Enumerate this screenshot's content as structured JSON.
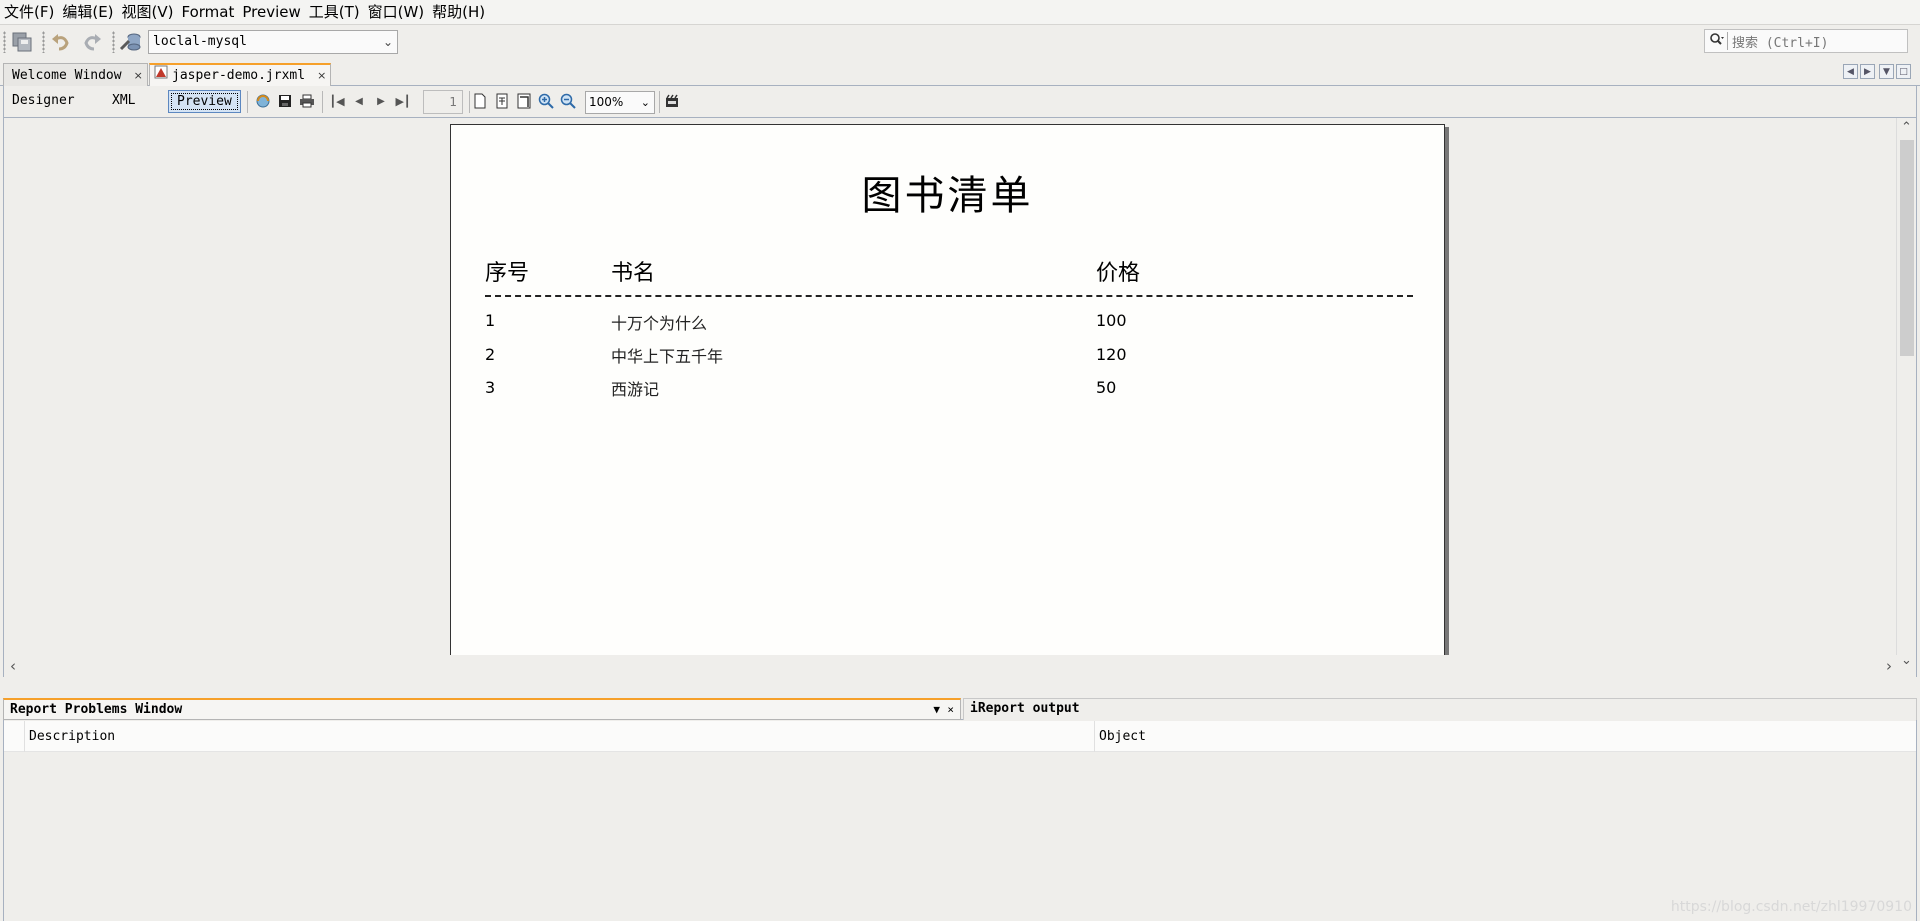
{
  "menu": [
    "文件(F)",
    "编辑(E)",
    "视图(V)",
    "Format",
    "Preview",
    "工具(T)",
    "窗口(W)",
    "帮助(H)"
  ],
  "toolbar": {
    "datasource": "loclal-mysql",
    "search_placeholder": "搜索 (Ctrl+I)"
  },
  "tabs": [
    {
      "label": "Welcome Window",
      "close": "×"
    },
    {
      "label": "jasper-demo.jrxml",
      "close": "×"
    }
  ],
  "designer_bar": {
    "modes": [
      "Designer",
      "XML",
      "Preview"
    ],
    "page_number": "1",
    "zoom": "100%"
  },
  "report": {
    "title": "图书清单",
    "columns": [
      "序号",
      "书名",
      "价格"
    ],
    "rows": [
      {
        "no": "1",
        "name": "十万个为什么",
        "price": "100"
      },
      {
        "no": "2",
        "name": "中华上下五千年",
        "price": "120"
      },
      {
        "no": "3",
        "name": "西游记",
        "price": "50"
      }
    ]
  },
  "bottom_panel": {
    "tabs": [
      "Report Problems Window",
      "iReport output"
    ],
    "columns": [
      "Description",
      "Object"
    ]
  },
  "watermark": "https://blog.csdn.net/zhl19970910",
  "colors": {
    "active_tab_accent": "#f6a02a",
    "selected_mode_bg": "#d4e3f4",
    "panel_border": "#a7b1c0"
  }
}
